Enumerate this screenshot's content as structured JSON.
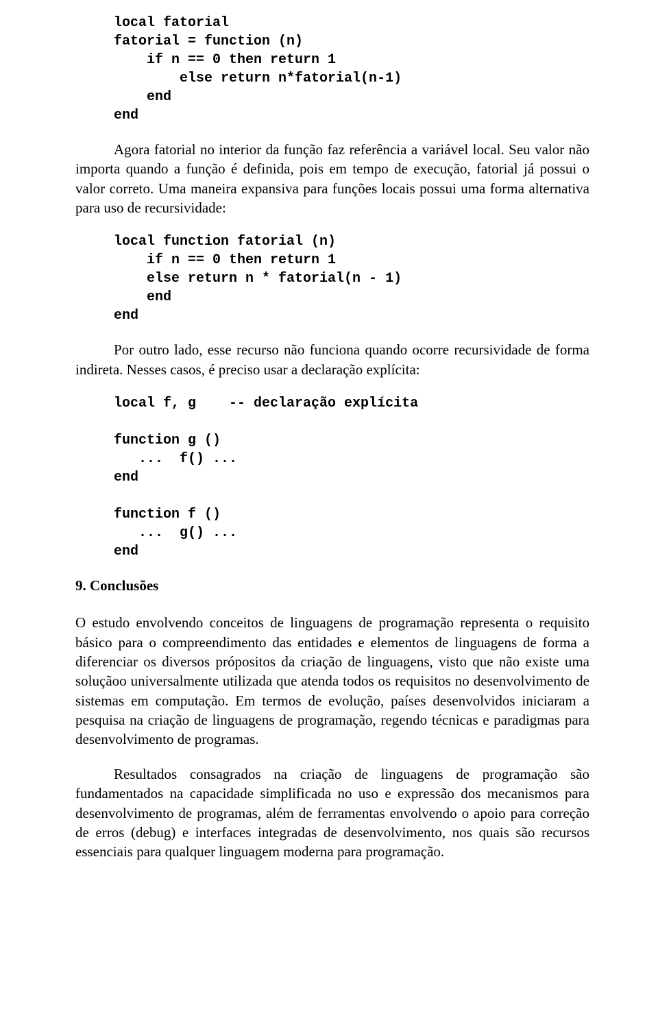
{
  "code1": "local fatorial\nfatorial = function (n)\n    if n == 0 then return 1\n        else return n*fatorial(n-1)\n    end\nend",
  "p1": "Agora fatorial no interior da função faz referência a variável local. Seu valor não importa quando a função é definida, pois em tempo de execução, fatorial já possui o valor correto. Uma maneira expansiva para funções locais possui uma forma alternativa para uso de recursividade:",
  "code2": "local function fatorial (n)\n    if n == 0 then return 1\n    else return n * fatorial(n - 1)\n    end\nend",
  "p2": "Por outro lado, esse recurso não funciona quando ocorre recursividade de forma indireta. Nesses casos, é preciso usar a declaração explícita:",
  "code3": "local f, g    -- declaração explícita\n\nfunction g ()\n   ...  f() ...\nend\n\nfunction f ()\n   ...  g() ...\nend",
  "h1": "9.   Conclusões",
  "p3": "O estudo envolvendo conceitos de linguagens de programação representa o requisito básico para o compreendimento das entidades e elementos de linguagens de forma a diferenciar os diversos própositos da criação de linguagens, visto que não existe uma soluçãoo universalmente utilizada que atenda todos os requisitos no desenvolvimento de sistemas em computação. Em termos de evolução, países desenvolvidos iniciaram a pesquisa na criação de linguagens de programação, regendo técnicas e paradigmas para desenvolvimento de programas.",
  "p4": "Resultados consagrados na criação de linguagens de programação são fundamentados na capacidade simplificada no uso e expressão dos mecanismos para desenvolvimento de programas, além de ferramentas envolvendo o apoio para correção de erros (debug) e interfaces integradas de desenvolvimento, nos quais são recursos essenciais para qualquer linguagem moderna para programação."
}
